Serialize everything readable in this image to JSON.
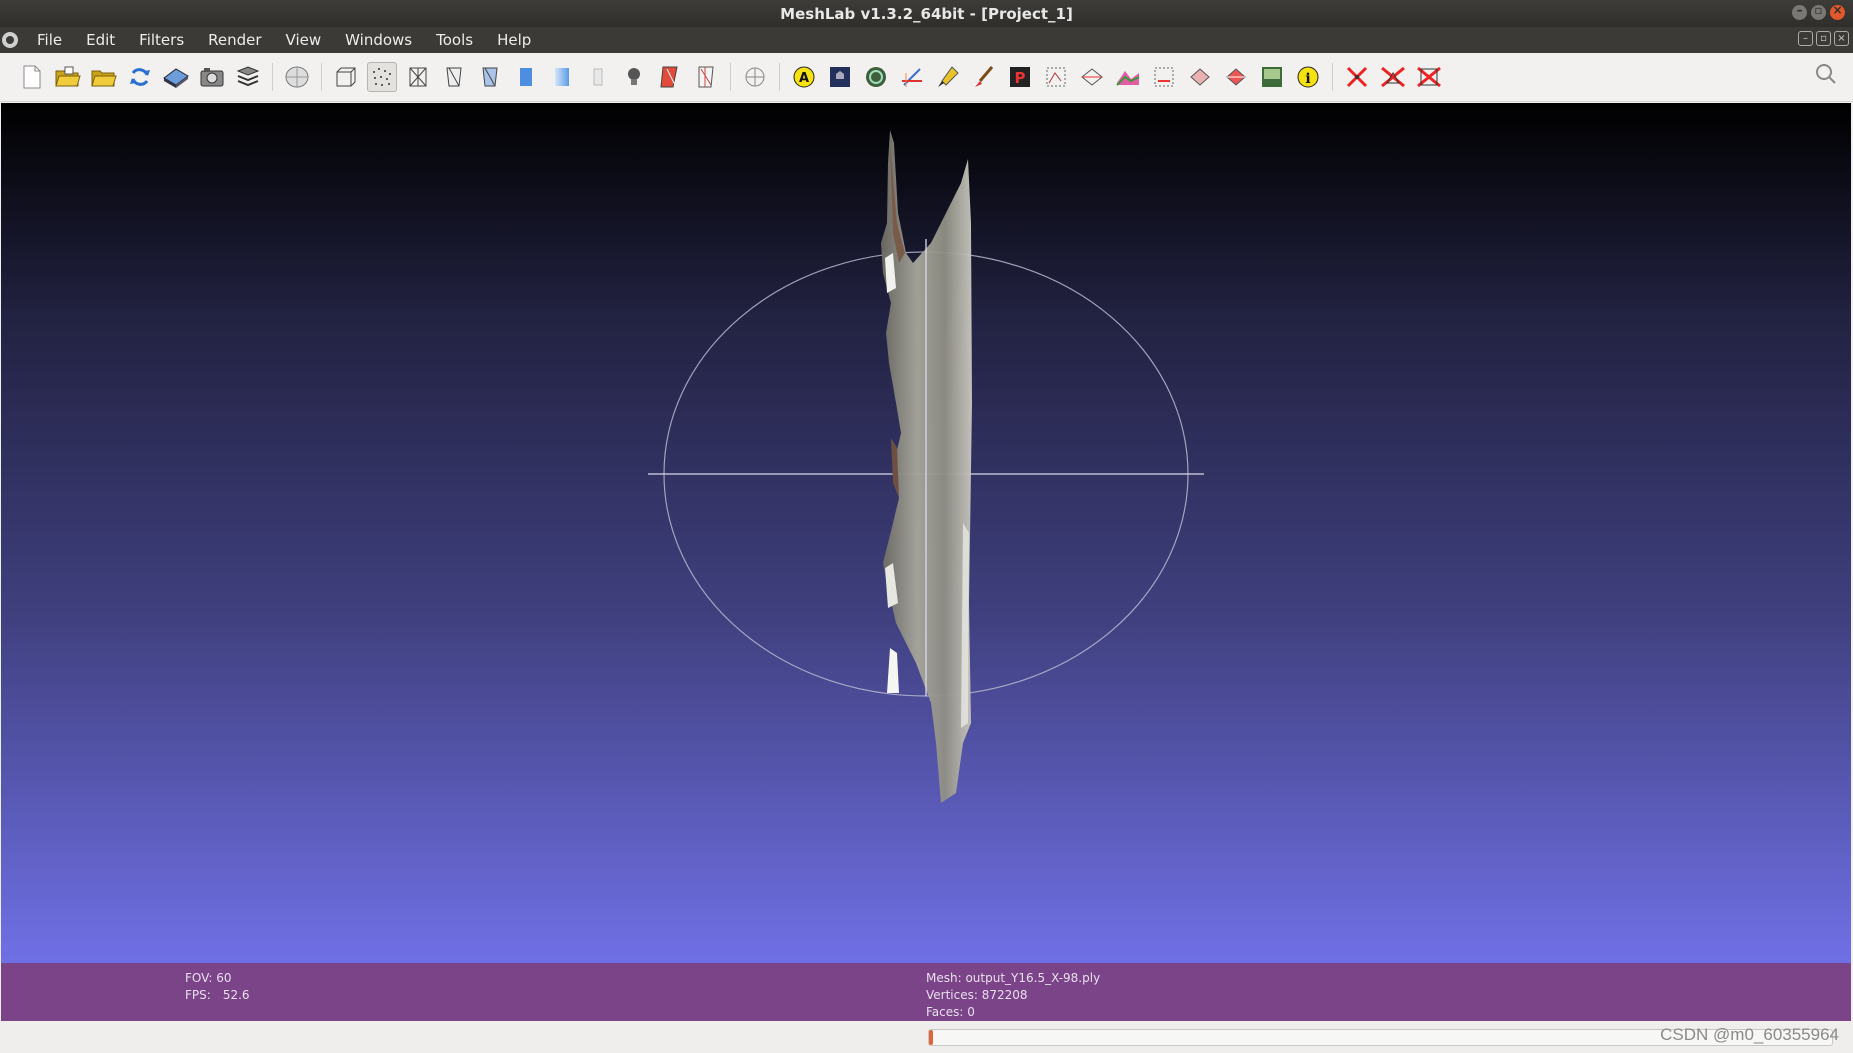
{
  "window": {
    "title": "MeshLab v1.3.2_64bit - [Project_1]"
  },
  "menu": [
    {
      "label": "File"
    },
    {
      "label": "Edit"
    },
    {
      "label": "Filters"
    },
    {
      "label": "Render"
    },
    {
      "label": "View"
    },
    {
      "label": "Windows"
    },
    {
      "label": "Tools"
    },
    {
      "label": "Help"
    }
  ],
  "toolbar": {
    "buttons": [
      "new-project-icon",
      "open-project-icon",
      "open-mesh-icon",
      "reload-icon",
      "save-icon",
      "snapshot-icon",
      "layers-icon",
      "globe-icon",
      "bounding-box-icon",
      "points-icon",
      "wireframe-icon",
      "hidden-lines-icon",
      "flat-lines-icon",
      "flat-icon",
      "smooth-icon",
      "texture-icon",
      "light-icon",
      "double-side-icon",
      "normals-icon",
      "trackball-icon",
      "annotation-icon",
      "manipulator-icon",
      "texture-paint-icon",
      "measure-icon",
      "paint-icon",
      "brush-icon",
      "pickpoints-icon",
      "selection-icon",
      "select-connected-icon",
      "quality-icon",
      "select-vertex-icon",
      "select-face-icon",
      "z-painting-icon",
      "raster-icon",
      "info-icon",
      "delete-vertices-icon",
      "delete-faces-icon",
      "delete-all-icon"
    ]
  },
  "info": {
    "fov_label": "FOV: 60",
    "fps_label": "FPS:",
    "fps_value": "52.6",
    "mesh_label": "Mesh: output_Y16.5_X-98.ply",
    "vertices_label": "Vertices: 872208",
    "faces_label": "Faces: 0"
  },
  "status": {
    "progress": 0.003
  },
  "watermark": "CSDN @m0_60355964",
  "colors": {
    "info_panel": "#7b4488",
    "viewport_top": "#000000",
    "viewport_bottom": "#7070e6",
    "progress_fill": "#e0653a"
  }
}
